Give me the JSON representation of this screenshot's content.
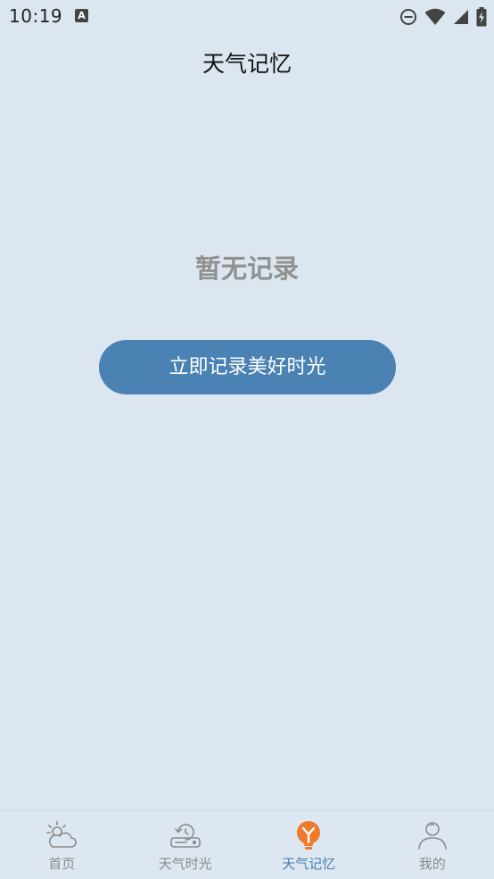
{
  "status_bar": {
    "time": "10:19",
    "notification_icon_letter": "A",
    "icons": [
      "dnd-icon",
      "wifi-icon",
      "signal-icon",
      "battery-charging-icon"
    ]
  },
  "header": {
    "title": "天气记忆"
  },
  "main": {
    "empty_message": "暂无记录",
    "record_button_label": "立即记录美好时光"
  },
  "bottom_nav": {
    "items": [
      {
        "label": "首页",
        "icon": "weather-home-icon",
        "active": false
      },
      {
        "label": "天气时光",
        "icon": "time-machine-icon",
        "active": false
      },
      {
        "label": "天气记忆",
        "icon": "memory-lightbulb-icon",
        "active": true
      },
      {
        "label": "我的",
        "icon": "profile-icon",
        "active": false
      }
    ]
  },
  "colors": {
    "background": "#dbe6f0",
    "accent": "#4a82b4",
    "active_icon": "#f07a2b",
    "inactive_text": "#8a8a8a",
    "empty_text": "#909090"
  }
}
